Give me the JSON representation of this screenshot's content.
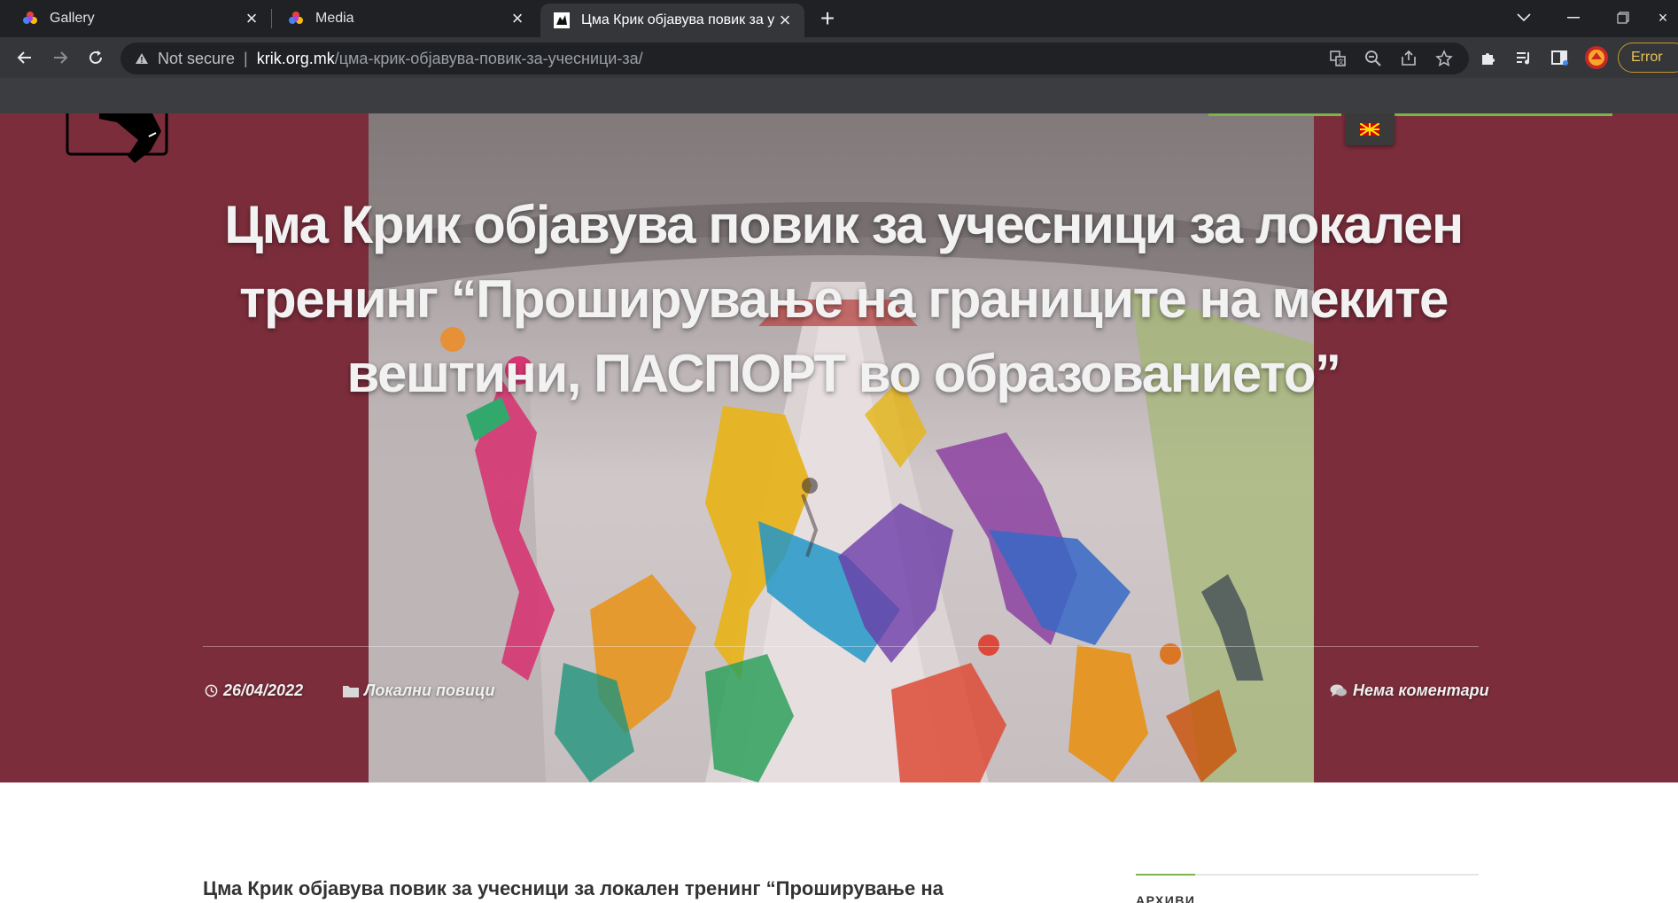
{
  "browser": {
    "tabs": [
      {
        "title": "Gallery",
        "favicon": "colorful-flower-icon"
      },
      {
        "title": "Media",
        "favicon": "colorful-flower-icon"
      },
      {
        "title": "Цма Крик објавува повик за учесници за",
        "favicon": "krik-site-icon",
        "active": true
      }
    ],
    "address": {
      "security": "Not secure",
      "host": "krik.org.mk",
      "path": "/цма-крик-објавува-повик-за-учесници-за/"
    },
    "profile_status": "Error"
  },
  "site": {
    "language_flag": "macedonian-flag-icon",
    "accent_color": "#7ab648",
    "hero_bg_color": "#7b2d3c"
  },
  "post": {
    "title": "Цма Крик објавува повик за учесници за локален тренинг “Проширување на границите на меките вештини, ПАСПОРТ во образованието”",
    "date": "26/04/2022",
    "category": "Локални повици",
    "comments": "Нема коментари",
    "lead": "Цма Крик објавува повик за учесници за локален тренинг “Проширување на"
  },
  "sidebar": {
    "archives_heading": "АРХИВИ"
  }
}
